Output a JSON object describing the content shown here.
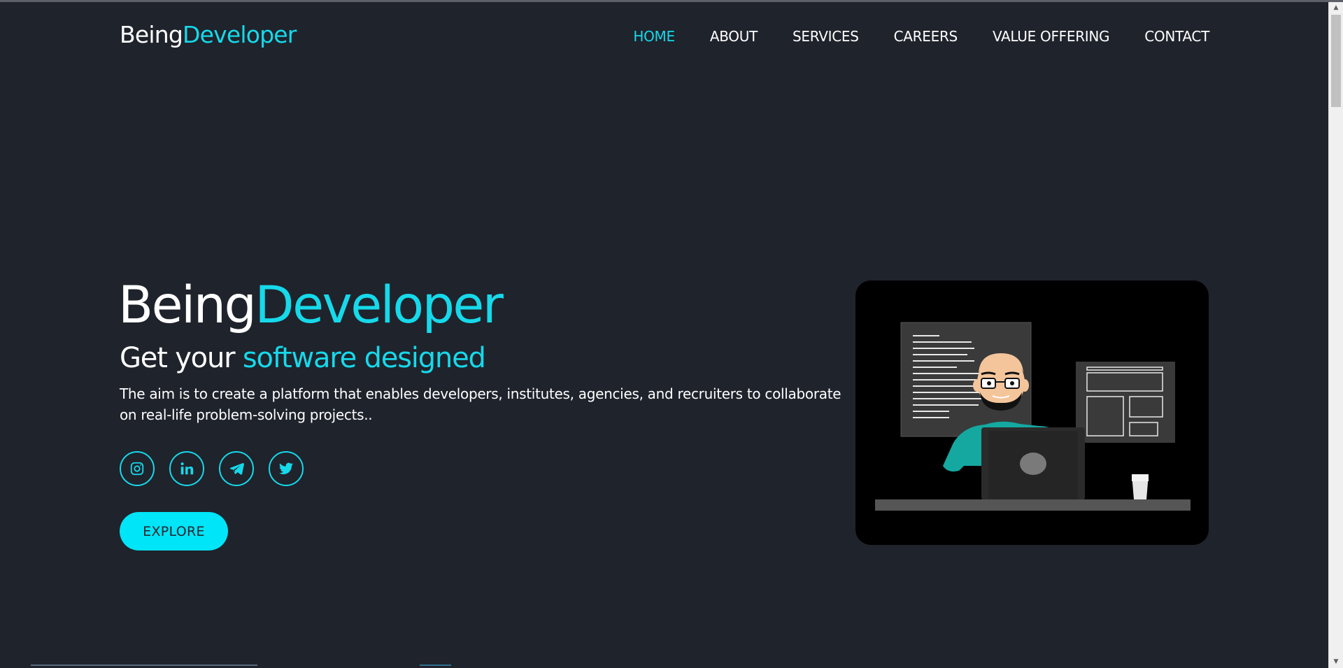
{
  "brand": {
    "part1": "Being",
    "part2": "Developer"
  },
  "nav": {
    "items": [
      {
        "label": "HOME",
        "active": true
      },
      {
        "label": "ABOUT",
        "active": false
      },
      {
        "label": "SERVICES",
        "active": false
      },
      {
        "label": "CAREERS",
        "active": false
      },
      {
        "label": "VALUE OFFERING",
        "active": false
      },
      {
        "label": "CONTACT",
        "active": false
      }
    ]
  },
  "hero": {
    "title_part1": "Being",
    "title_part2": "Developer",
    "subtitle_part1": "Get your ",
    "subtitle_part2": "software designed",
    "description": "The aim is to create a platform that enables developers, institutes, agencies, and recruiters to collaborate on real-life problem-solving projects..",
    "socials": [
      {
        "icon": "instagram-icon"
      },
      {
        "icon": "linkedin-icon"
      },
      {
        "icon": "telegram-icon"
      },
      {
        "icon": "twitter-icon"
      }
    ],
    "explore_label": "EXPLORE"
  },
  "colors": {
    "background": "#1f232c",
    "accent": "#16d9ea",
    "button": "#00e5f7",
    "text": "#ffffff"
  }
}
